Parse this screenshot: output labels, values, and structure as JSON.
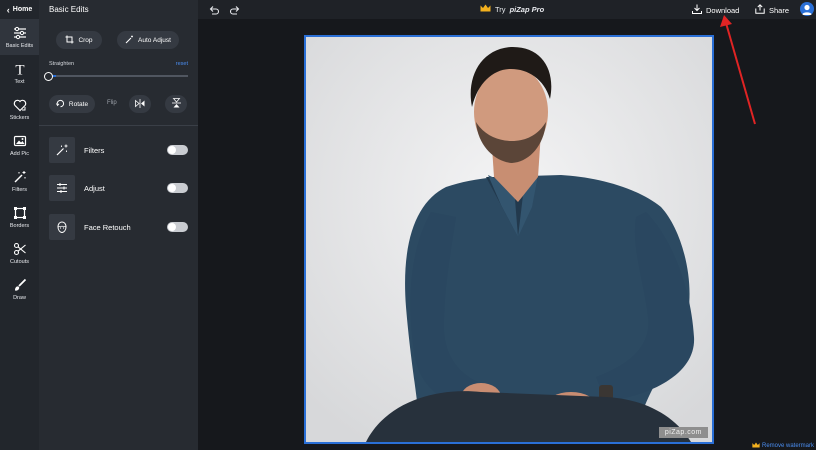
{
  "rail": {
    "home_label": "Home",
    "items": [
      {
        "label": "Basic Edits",
        "icon": "sliders-icon"
      },
      {
        "label": "Text",
        "icon": "text-icon"
      },
      {
        "label": "Stickers",
        "icon": "sticker-icon"
      },
      {
        "label": "Add Pic",
        "icon": "add-picture-icon"
      },
      {
        "label": "Filters",
        "icon": "magic-wand-icon"
      },
      {
        "label": "Borders",
        "icon": "border-icon"
      },
      {
        "label": "Cutouts",
        "icon": "cutout-icon"
      },
      {
        "label": "Draw",
        "icon": "brush-icon"
      }
    ]
  },
  "panel": {
    "title": "Basic Edits",
    "crop_label": "Crop",
    "auto_adjust_label": "Auto Adjust",
    "straighten_label": "Straighten",
    "reset_label": "reset",
    "straighten_value": 0.05,
    "rotate_label": "Rotate",
    "flip_label": "Flip",
    "tools": [
      {
        "label": "Filters",
        "icon": "magic-wand-icon",
        "enabled": false
      },
      {
        "label": "Adjust",
        "icon": "adjust-sliders-icon",
        "enabled": false
      },
      {
        "label": "Face Retouch",
        "icon": "face-icon",
        "enabled": false
      }
    ]
  },
  "topbar": {
    "try_prefix": "Try",
    "pro_label": "piZap Pro",
    "download_label": "Download",
    "share_label": "Share"
  },
  "canvas": {
    "watermark": "piZap.com",
    "remove_watermark": "Remove watermark"
  },
  "colors": {
    "accent": "#2a6fd6",
    "crown": "#f2b01e",
    "arrow": "#e02424"
  }
}
